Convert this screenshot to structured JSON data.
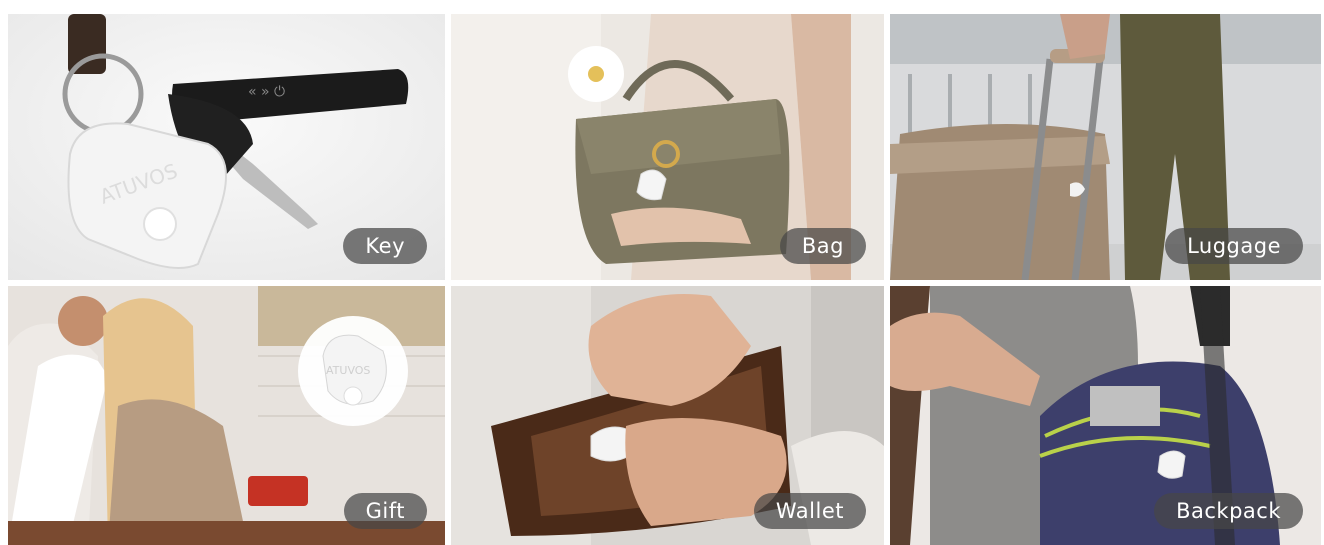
{
  "tiles": [
    {
      "label": "Key",
      "brand": "ATUVOS"
    },
    {
      "label": "Bag"
    },
    {
      "label": "Luggage"
    },
    {
      "label": "Gift",
      "brand": "ATUVOS"
    },
    {
      "label": "Wallet"
    },
    {
      "label": "Backpack"
    }
  ],
  "colors": {
    "label_bg": "#464646",
    "label_text": "#ffffff",
    "tracker": "#f2f2f2"
  }
}
